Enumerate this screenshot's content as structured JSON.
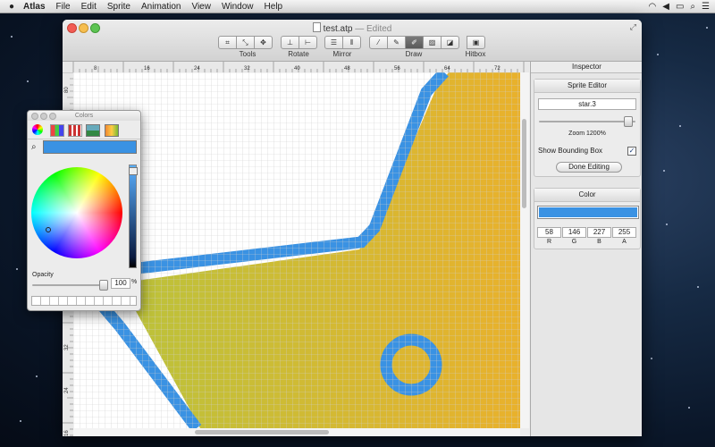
{
  "menubar": {
    "app_name": "Atlas",
    "items": [
      "File",
      "Edit",
      "Sprite",
      "Animation",
      "View",
      "Window",
      "Help"
    ],
    "status_icons": [
      "wifi-icon",
      "volume-icon",
      "battery-icon",
      "spotlight-icon",
      "notifications-icon"
    ]
  },
  "window": {
    "filename": "test.atp",
    "edited_suffix": "— Edited",
    "toolbar_groups": [
      {
        "label": "Tools",
        "icons": [
          "crop-icon",
          "scale-icon",
          "move-icon"
        ]
      },
      {
        "label": "Rotate",
        "icons": [
          "rotate-left-icon",
          "rotate-right-icon"
        ]
      },
      {
        "label": "Mirror",
        "icons": [
          "flip-vertical-icon",
          "flip-horizontal-icon"
        ]
      },
      {
        "label": "Draw",
        "icons": [
          "eyedropper-icon",
          "pencil-icon",
          "eraser-icon",
          "fill-icon",
          "line-icon"
        ]
      },
      {
        "label": "Hitbox",
        "icons": [
          "hitbox-icon"
        ]
      }
    ],
    "draw_selected": "eraser-icon"
  },
  "ruler": {
    "h_labels": [
      "8",
      "16",
      "24",
      "32",
      "40",
      "48",
      "56",
      "64",
      "72"
    ],
    "v_labels": [
      "80",
      "72",
      "64",
      "56",
      "48",
      "40",
      "32",
      "24",
      "16"
    ]
  },
  "inspector": {
    "title": "Inspector",
    "sprite_editor": {
      "title": "Sprite Editor",
      "sprite_name": "star.3",
      "zoom_label": "Zoom 1200%",
      "zoom_fraction": 0.95,
      "show_bounding_box_label": "Show Bounding Box",
      "show_bounding_box": true,
      "done_button": "Done Editing"
    },
    "color": {
      "title": "Color",
      "swatch": "#3a92e3",
      "r": "58",
      "g": "146",
      "b": "227",
      "a": "255",
      "r_label": "R",
      "g_label": "G",
      "b_label": "B",
      "a_label": "A"
    }
  },
  "colors_panel": {
    "title": "Colors",
    "current_color": "#3a92e3",
    "opacity_label": "Opacity",
    "opacity_value": "100",
    "opacity_unit": "%",
    "tabs": [
      "color-wheel-icon",
      "sliders-icon",
      "palettes-icon",
      "image-palettes-icon",
      "crayons-icon"
    ]
  },
  "canvas_colors": {
    "fill_left": "#bdc238",
    "fill_right": "#e8b22e",
    "stroke": "#3a92e3",
    "grid": "#d0d0d0"
  }
}
